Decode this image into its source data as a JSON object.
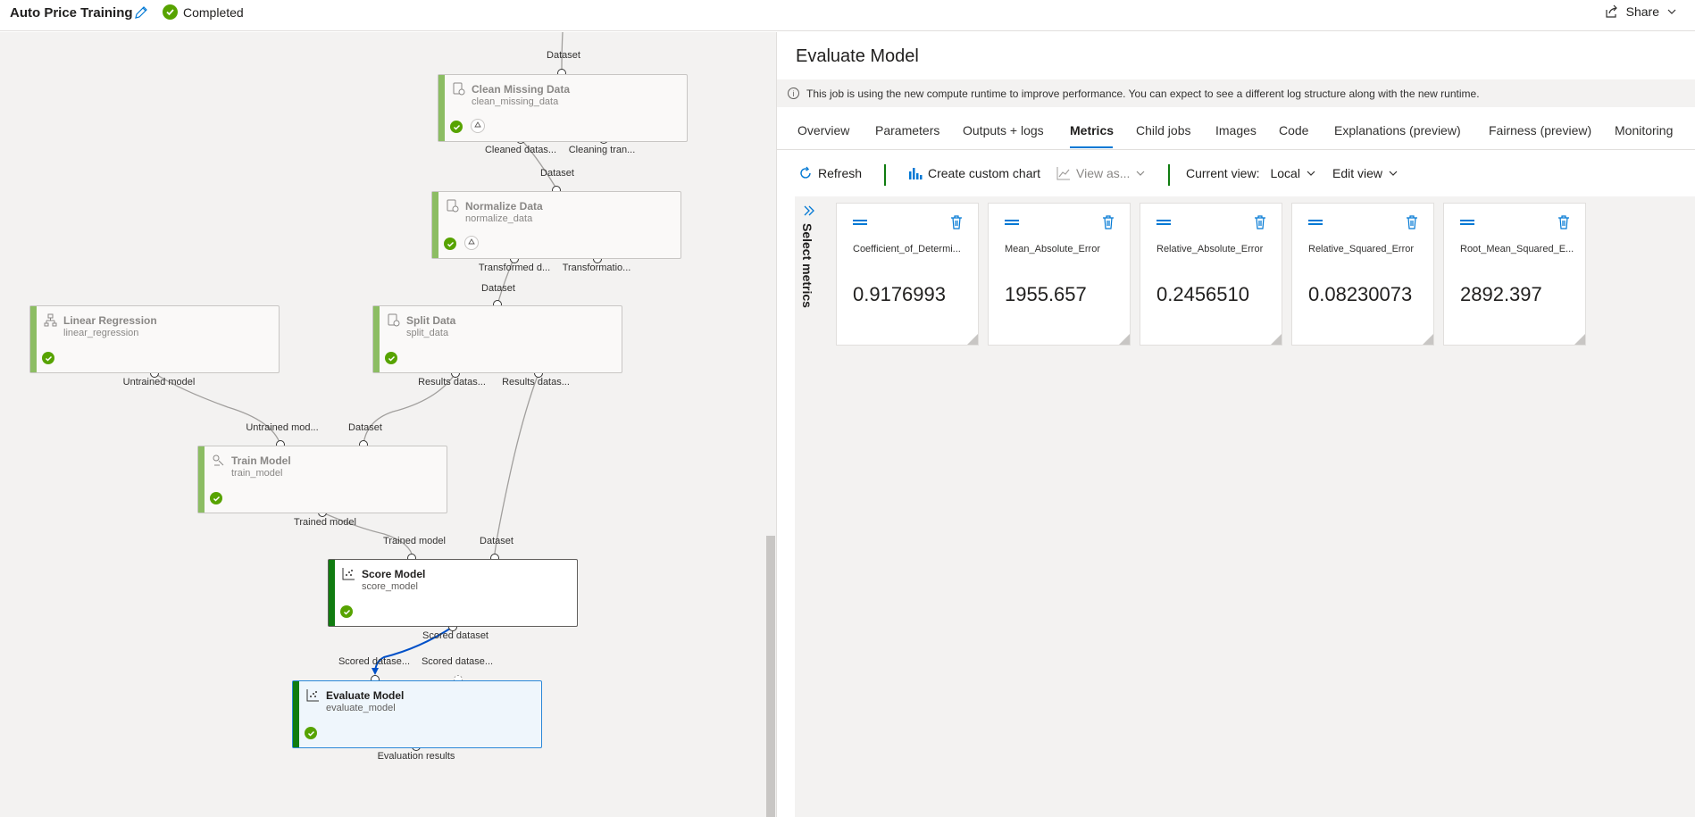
{
  "header": {
    "title": "Auto Price Training",
    "status": "Completed",
    "share_label": "Share"
  },
  "pipeline": {
    "nodes": [
      {
        "title": "Clean Missing Data",
        "subtitle": "clean_missing_data"
      },
      {
        "title": "Normalize Data",
        "subtitle": "normalize_data"
      },
      {
        "title": "Linear Regression",
        "subtitle": "linear_regression"
      },
      {
        "title": "Split Data",
        "subtitle": "split_data"
      },
      {
        "title": "Train Model",
        "subtitle": "train_model"
      },
      {
        "title": "Score Model",
        "subtitle": "score_model"
      },
      {
        "title": "Evaluate Model",
        "subtitle": "evaluate_model"
      }
    ],
    "port_labels": [
      "Dataset",
      "Cleaned datas...",
      "Cleaning tran...",
      "Dataset",
      "Transformed d...",
      "Transformatio...",
      "Dataset",
      "Untrained model",
      "Results datas...",
      "Results datas...",
      "Untrained mod...",
      "Dataset",
      "Trained model",
      "Trained model",
      "Dataset",
      "Scored dataset",
      "Scored datase...",
      "Scored datase...",
      "Evaluation results"
    ]
  },
  "panel": {
    "title": "Evaluate Model",
    "info": "This job is using the new compute runtime to improve performance. You can expect to see a different log structure along with the new runtime.",
    "tabs": [
      "Overview",
      "Parameters",
      "Outputs + logs",
      "Metrics",
      "Child jobs",
      "Images",
      "Code",
      "Explanations (preview)",
      "Fairness (preview)",
      "Monitoring"
    ],
    "active_tab": "Metrics",
    "toolbar": {
      "refresh": "Refresh",
      "create_chart": "Create custom chart",
      "view_as": "View as...",
      "current_view_label": "Current view:",
      "current_view_value": "Local",
      "edit_view": "Edit view"
    },
    "select_metrics": "Select metrics",
    "metrics": [
      {
        "name": "Coefficient_of_Determination",
        "display_name": "Coefficient_of_Determi...",
        "value": "0.9176993"
      },
      {
        "name": "Mean_Absolute_Error",
        "display_name": "Mean_Absolute_Error",
        "value": "1955.657"
      },
      {
        "name": "Relative_Absolute_Error",
        "display_name": "Relative_Absolute_Error",
        "value": "0.2456510"
      },
      {
        "name": "Relative_Squared_Error",
        "display_name": "Relative_Squared_Error",
        "value": "0.08230073"
      },
      {
        "name": "Root_Mean_Squared_Error",
        "display_name": "Root_Mean_Squared_E...",
        "value": "2892.397"
      }
    ]
  },
  "colors": {
    "accent": "#0078d4",
    "success": "#57a300",
    "node_bar": "#107c10"
  }
}
